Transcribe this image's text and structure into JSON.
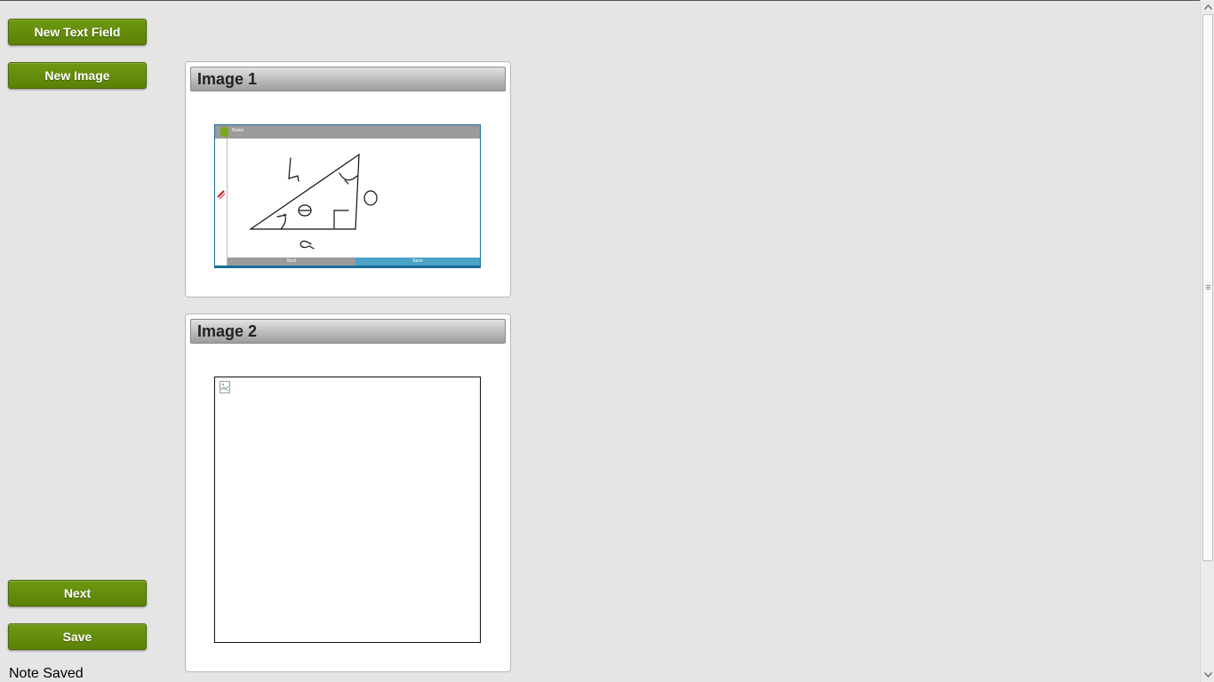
{
  "sidebar": {
    "new_text_field_label": "New Text Field",
    "new_image_label": "New Image",
    "next_label": "Next",
    "save_label": "Save",
    "status_text": "Note Saved"
  },
  "cards": [
    {
      "title": "Image 1",
      "thumbnail": {
        "app_title": "Notes",
        "next_label": "Next",
        "save_label": "Save"
      }
    },
    {
      "title": "Image 2",
      "image_state": "broken-image-icon"
    }
  ],
  "colors": {
    "button_green": "#5f870a",
    "page_background": "#e5e5e5",
    "thumb_save_blue": "#4ba3c7"
  }
}
